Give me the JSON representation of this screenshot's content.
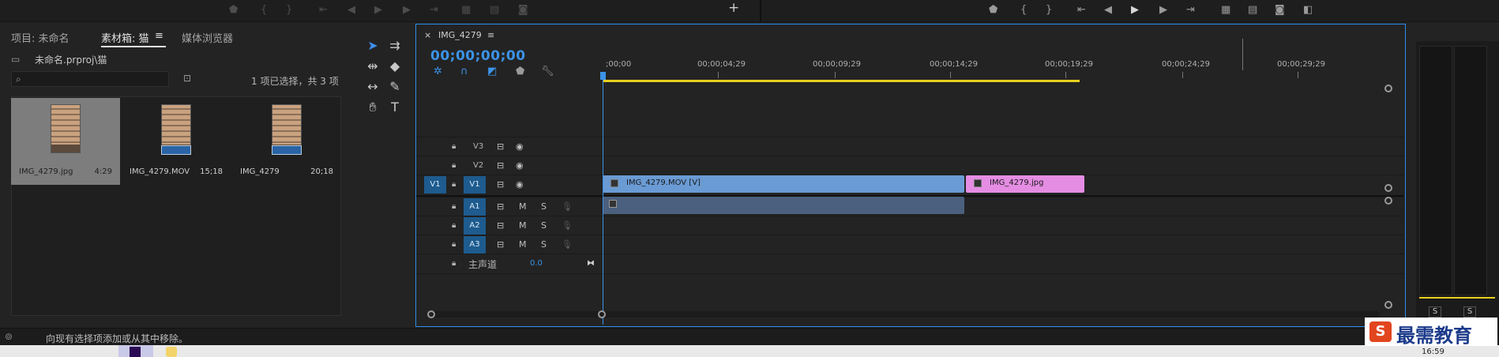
{
  "top_controls": {
    "left_icons": [
      "marker-icon",
      "in-point-icon",
      "out-point-icon",
      "go-to-in-icon",
      "step-back-icon",
      "play-icon",
      "step-forward-icon",
      "go-to-out-icon",
      "insert-icon",
      "overwrite-icon",
      "export-frame-icon"
    ],
    "add_label": "+",
    "right_icons": [
      "marker-icon",
      "in-point-icon",
      "out-point-icon",
      "go-to-in-icon",
      "step-back-icon",
      "play-icon",
      "step-forward-icon",
      "go-to-out-icon",
      "lift-icon",
      "extract-icon",
      "export-frame-icon",
      "compare-icon"
    ]
  },
  "project_panel": {
    "tabs": [
      {
        "label": "项目: 未命名"
      },
      {
        "label": "素材箱: 猫"
      },
      {
        "label": "媒体浏览器"
      }
    ],
    "menu_glyph": "≡",
    "path": "未命名.prproj\\猫",
    "search_placeholder": "",
    "selection_status": "1 项已选择，共 3 项",
    "items": [
      {
        "name": "IMG_4279.jpg",
        "duration": "4:29"
      },
      {
        "name": "IMG_4279.MOV",
        "duration": "15;18"
      },
      {
        "name": "IMG_4279",
        "duration": "20;18"
      }
    ]
  },
  "tools": [
    "selection-tool",
    "track-select-tool",
    "ripple-edit-tool",
    "razor-tool",
    "slip-tool",
    "pen-tool",
    "hand-tool",
    "type-tool"
  ],
  "timeline": {
    "sequence_tab": "IMG_4279",
    "close_glyph": "×",
    "menu_glyph": "≡",
    "timecode": "00;00;00;00",
    "ruler_labels": [
      ";00;00",
      "00;00;04;29",
      "00;00;09;29",
      "00;00;14;29",
      "00;00;19;29",
      "00;00;24;29",
      "00;00;29;29"
    ],
    "video_tracks": [
      {
        "label": "V3",
        "source": ""
      },
      {
        "label": "V2",
        "source": ""
      },
      {
        "label": "V1",
        "source": "V1"
      }
    ],
    "audio_tracks": [
      {
        "label": "A1",
        "m": "M",
        "s": "S"
      },
      {
        "label": "A2",
        "m": "M",
        "s": "S"
      },
      {
        "label": "A3",
        "m": "M",
        "s": "S"
      }
    ],
    "master": {
      "label": "主声道",
      "value": "0.0"
    },
    "clips": [
      {
        "label": "IMG_4279.MOV [V]",
        "color": "#6a9bd4"
      },
      {
        "label": "IMG_4279.jpg",
        "color": "#e58de3"
      }
    ],
    "audio_clip_color": "#4a607e"
  },
  "meter": {
    "s1": "S",
    "s2": "S"
  },
  "status_message": "向现有选择项添加或从其中移除。",
  "watermark": "最需教育",
  "clock": "16:59",
  "colors": {
    "accent": "#3b93e8",
    "workarea": "#e7cf1c",
    "target": "#1e5b8e"
  }
}
